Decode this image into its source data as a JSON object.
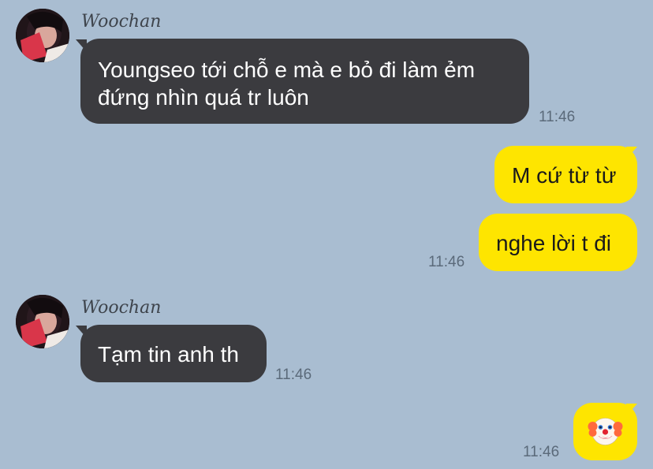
{
  "theme": {
    "background": "#a9bdd1",
    "incoming_bubble": "#3b3b3f",
    "outgoing_bubble": "#fee500",
    "timestamp_color": "#5b6a7a"
  },
  "messages": [
    {
      "direction": "incoming",
      "sender": "Woochan",
      "lines": [
        "Youngseo tới chỗ e mà e bỏ đi làm ẻm",
        "đứng nhìn quá tr luôn"
      ],
      "time": "11:46"
    },
    {
      "direction": "outgoing",
      "text": "M cứ từ từ"
    },
    {
      "direction": "outgoing",
      "text": "nghe lời t đi",
      "time": "11:46"
    },
    {
      "direction": "incoming",
      "sender": "Woochan",
      "text": "Tạm tin anh th",
      "time": "11:46"
    },
    {
      "direction": "outgoing",
      "sticker": "clown-face-emoji",
      "time": "11:46"
    }
  ]
}
